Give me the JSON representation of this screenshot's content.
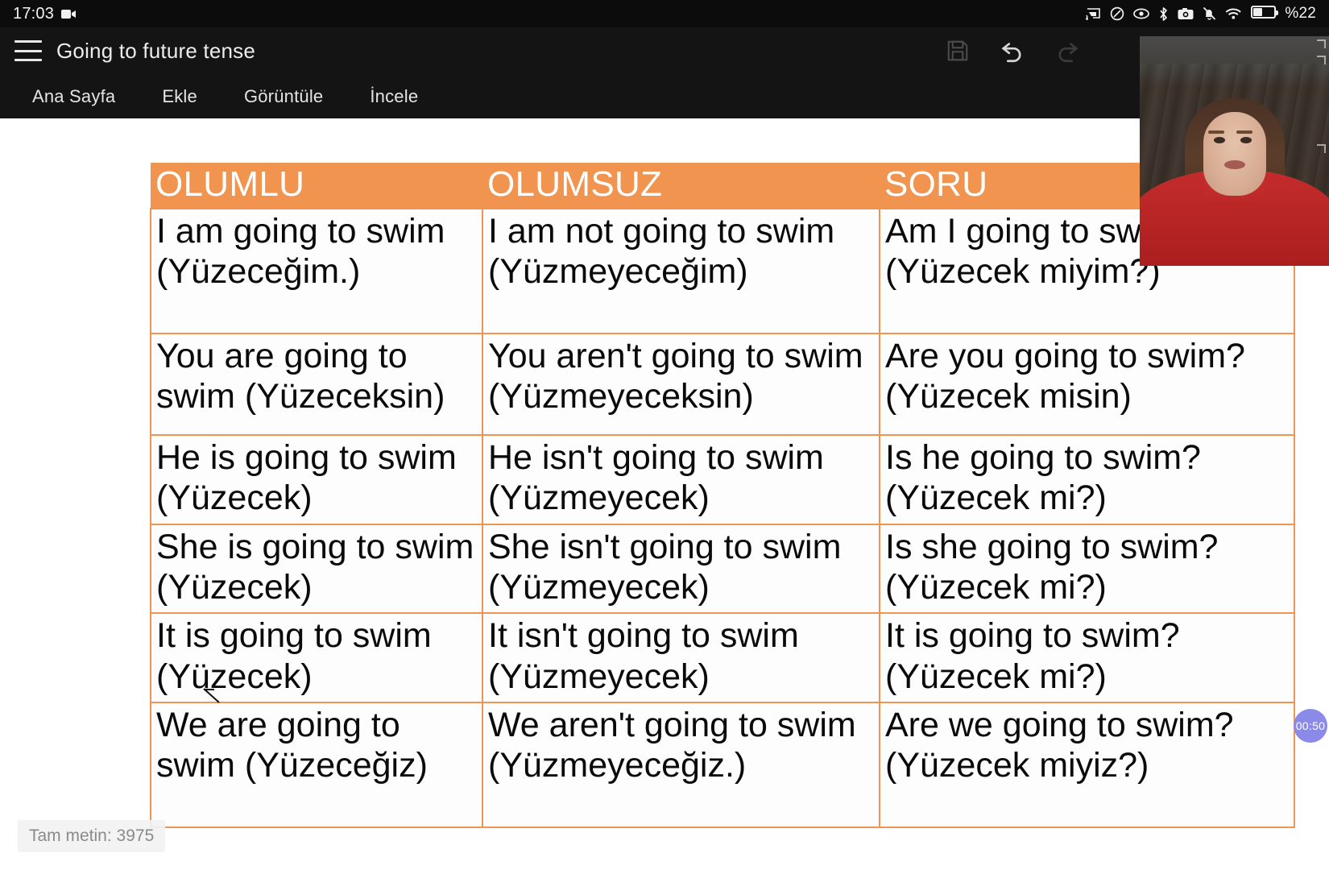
{
  "status_bar": {
    "time": "17:03",
    "recording_icon": "video-camera-icon",
    "icons": [
      "cast-icon",
      "dnd-icon",
      "eye-icon",
      "bluetooth-icon",
      "camera-icon",
      "notification-muted-icon",
      "wifi-icon",
      "battery-icon"
    ],
    "battery_percent": "%22"
  },
  "app_bar": {
    "menu_icon": "hamburger-menu-icon",
    "document_title": "Going to future tense",
    "actions": [
      {
        "name": "save-icon",
        "label": "Save",
        "enabled": false
      },
      {
        "name": "undo-icon",
        "label": "Undo",
        "enabled": true
      },
      {
        "name": "redo-icon",
        "label": "Redo",
        "enabled": false
      }
    ]
  },
  "ribbon": {
    "tabs": [
      {
        "label": "Ana Sayfa",
        "active": false
      },
      {
        "label": "Ekle",
        "active": false
      },
      {
        "label": "Görüntüle",
        "active": false
      },
      {
        "label": "İncele",
        "active": false
      }
    ]
  },
  "document": {
    "table": {
      "header_bg": "#F0944F",
      "border_color": "#F0944F",
      "headers": [
        "OLUMLU",
        "OLUMSUZ",
        "SORU"
      ],
      "rows": [
        {
          "olumlu": "I am going to swim (Yüzeceğim.)",
          "olumsuz": "I am not going to swim (Yüzmeyeceğim)",
          "soru": "Am I going to swim? (Yüzecek miyim?)"
        },
        {
          "olumlu": "You are going to swim (Yüzeceksin)",
          "olumsuz": "You aren't going to swim (Yüzmeyeceksin)",
          "soru": "Are you going to swim? (Yüzecek misin)"
        },
        {
          "olumlu": "He is going to swim (Yüzecek)",
          "olumsuz": "He isn't going to swim (Yüzmeyecek)",
          "soru": "Is he going to swim? (Yüzecek mi?)"
        },
        {
          "olumlu": "She is going to swim (Yüzecek)",
          "olumsuz": "She isn't going to swim (Yüzmeyecek)",
          "soru": "Is she going to swim? (Yüzecek mi?)"
        },
        {
          "olumlu": "It is going to swim (Yüzecek)",
          "olumsuz": "It isn't going to swim (Yüzmeyecek)",
          "soru": "It is going to swim? (Yüzecek mi?)"
        },
        {
          "olumlu": "We are going to swim (Yüzeceğiz)",
          "olumsuz": "We aren't going to swim (Yüzmeyeceğiz.)",
          "soru": "Are we going to swim? (Yüzecek miyiz?)"
        }
      ]
    }
  },
  "overlays": {
    "webcam": {
      "name": "webcam-preview",
      "description": "presenter video"
    },
    "timer_badge": "00:50",
    "word_count": "Tam metin: 3975"
  }
}
